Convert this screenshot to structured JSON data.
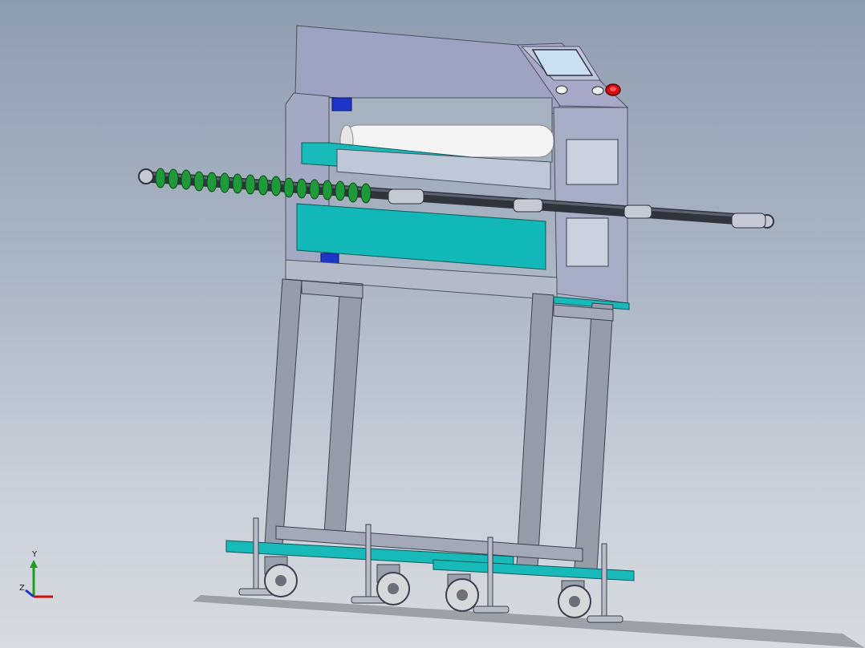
{
  "viewport": {
    "background_top": "#8f9db0",
    "background_bottom": "#d8dbe0"
  },
  "model": {
    "frame_color": "#8c96a6",
    "panel_color": "#12b8b8",
    "roller_color": "#f4f4f4",
    "spring_color": "#1f9a3a",
    "emergency_stop_color": "#d01010"
  },
  "triad": {
    "y_label": "Y",
    "z_label": "Z",
    "icon": "axis-triad-icon"
  }
}
